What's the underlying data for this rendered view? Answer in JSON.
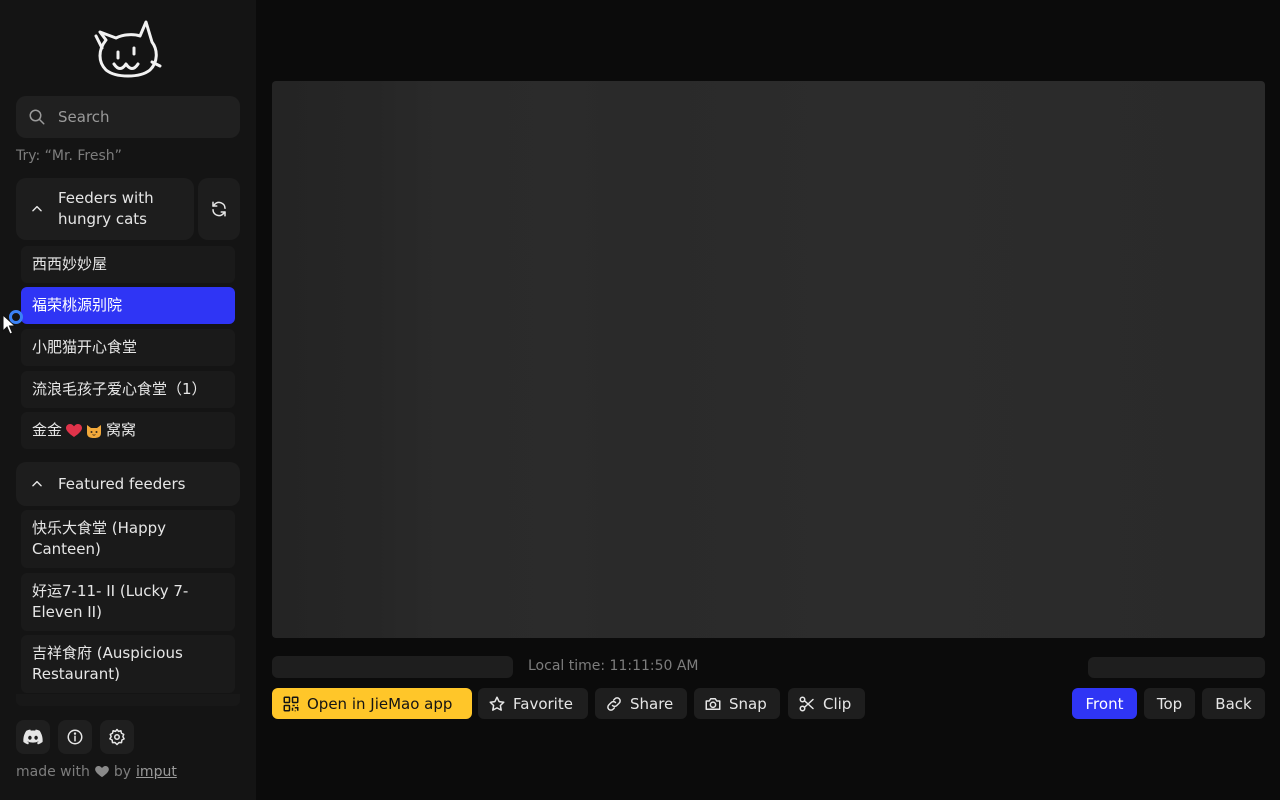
{
  "search": {
    "placeholder": "Search",
    "hint": "Try: “Mr. Fresh”"
  },
  "sections": [
    {
      "title": "Feeders with hungry cats",
      "items": [
        {
          "label": "西西妙妙屋"
        },
        {
          "label": "福荣桃源别院",
          "selected": true
        },
        {
          "label": "小肥猫开心食堂"
        },
        {
          "label": "流浪毛孩子爱心食堂（1）"
        },
        {
          "label": "金金",
          "label_suffix": "窝窝",
          "emoji": [
            "red-heart",
            "cat-face"
          ]
        }
      ]
    },
    {
      "title": "Featured feeders",
      "items": [
        {
          "label": "快乐大食堂 (Happy Canteen)"
        },
        {
          "label": "好运7-11- II (Lucky 7-Eleven II)"
        },
        {
          "label": "吉祥食府 (Auspicious Restaurant)"
        }
      ]
    }
  ],
  "footer": {
    "made_prefix": "made with",
    "made_by": "by",
    "author": "imput"
  },
  "viewer": {
    "local_time": "Local time: 11:11:50 AM"
  },
  "actions": {
    "open_app": "Open in JieMao app",
    "favorite": "Favorite",
    "share": "Share",
    "snap": "Snap",
    "clip": "Clip"
  },
  "camera_views": {
    "front": "Front",
    "top": "Top",
    "back": "Back",
    "selected": "Front"
  },
  "colors": {
    "accent": "#2f35f5",
    "yellow": "#ffc629",
    "bg": "#0b0b0b",
    "sidebar": "#141414"
  },
  "icons": [
    "cat-logo",
    "search-icon",
    "chevron-up-icon",
    "refresh-icon",
    "discord-icon",
    "info-icon",
    "settings-icon",
    "heart-icon",
    "qr-code-icon",
    "star-icon",
    "link-icon",
    "camera-icon",
    "scissors-icon"
  ]
}
